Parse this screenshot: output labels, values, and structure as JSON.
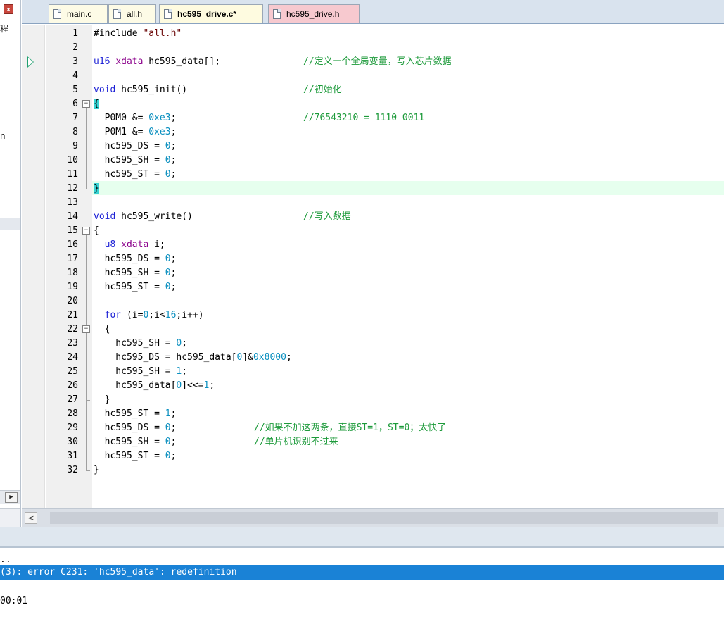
{
  "window": {
    "left_pane_fragments": [
      "程",
      "n"
    ]
  },
  "tabs": [
    {
      "label": "main.c",
      "active": false,
      "color": "#fdfbe6"
    },
    {
      "label": "all.h",
      "active": false,
      "color": "#fdfbe6"
    },
    {
      "label": "hc595_drive.c*",
      "active": true,
      "color": "#fefbe0"
    },
    {
      "label": "hc595_drive.h",
      "active": false,
      "color": "#f7c9cf"
    }
  ],
  "editor": {
    "line_numbers": [
      "1",
      "2",
      "3",
      "4",
      "5",
      "6",
      "7",
      "8",
      "9",
      "10",
      "11",
      "12",
      "13",
      "14",
      "15",
      "16",
      "17",
      "18",
      "19",
      "20",
      "21",
      "22",
      "23",
      "24",
      "25",
      "26",
      "27",
      "28",
      "29",
      "30",
      "31",
      "32"
    ],
    "current_line": 12,
    "bookmark_line": 3,
    "colors": {
      "keyword": "#1e22d6",
      "number": "#0a8fbf",
      "comment": "#1c9a3a",
      "string": "#6d0a0a",
      "current_line_bg": "#e6ffee",
      "brace_highlight": "#37d3d3"
    },
    "lines": [
      {
        "t": "#include \"all.h\""
      },
      {
        "t": ""
      },
      {
        "t": "u16 xdata hc595_data[];",
        "c": "//定义一个全局变量，写入芯片数据"
      },
      {
        "t": ""
      },
      {
        "t": "void hc595_init()",
        "c": "//初始化"
      },
      {
        "t": "{"
      },
      {
        "t": "  P0M0 &= 0xe3;",
        "c": "//76543210 = 1110 0011"
      },
      {
        "t": "  P0M1 &= 0xe3;"
      },
      {
        "t": "  hc595_DS = 0;"
      },
      {
        "t": "  hc595_SH = 0;"
      },
      {
        "t": "  hc595_ST = 0;"
      },
      {
        "t": "}"
      },
      {
        "t": ""
      },
      {
        "t": "void hc595_write()",
        "c": "//写入数据"
      },
      {
        "t": "{"
      },
      {
        "t": "  u8 xdata i;"
      },
      {
        "t": "  hc595_DS = 0;"
      },
      {
        "t": "  hc595_SH = 0;"
      },
      {
        "t": "  hc595_ST = 0;"
      },
      {
        "t": ""
      },
      {
        "t": "  for (i=0;i<16;i++)"
      },
      {
        "t": "  {"
      },
      {
        "t": "    hc595_SH = 0;"
      },
      {
        "t": "    hc595_DS = hc595_data[0]&0x8000;"
      },
      {
        "t": "    hc595_SH = 1;"
      },
      {
        "t": "    hc595_data[0]<<=1;"
      },
      {
        "t": "  }"
      },
      {
        "t": "  hc595_ST = 1;"
      },
      {
        "t": "  hc595_DS = 0;",
        "c": "//如果不加这两条，直接ST=1，ST=0；太快了"
      },
      {
        "t": "  hc595_SH = 0;",
        "c": "//单片机识别不过来"
      },
      {
        "t": "  hc595_ST = 0;"
      },
      {
        "t": "}"
      }
    ]
  },
  "output": {
    "line1": "..",
    "line2": "(3): error C231: 'hc595_data': redefinition",
    "line3": "00:01",
    "error_highlight_color": "#1a82d6"
  }
}
